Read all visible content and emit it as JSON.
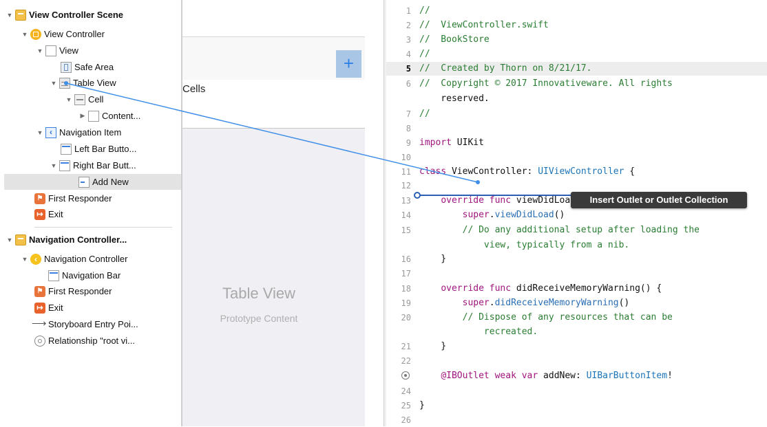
{
  "outline": {
    "items": [
      {
        "label": "View Controller Scene",
        "icon": "scene-icon",
        "bold": true
      },
      {
        "label": "View Controller",
        "icon": "view-controller-icon"
      },
      {
        "label": "View",
        "icon": "view-icon"
      },
      {
        "label": "Safe Area",
        "icon": "safe-area-icon"
      },
      {
        "label": "Table View",
        "icon": "table-view-icon"
      },
      {
        "label": "Cell",
        "icon": "cell-icon"
      },
      {
        "label": "Content...",
        "icon": "content-view-icon"
      },
      {
        "label": "Navigation Item",
        "icon": "navigation-item-icon"
      },
      {
        "label": "Left Bar Butto...",
        "icon": "bar-button-icon"
      },
      {
        "label": "Right Bar Butt...",
        "icon": "bar-button-icon"
      },
      {
        "label": "Add New",
        "icon": "bar-button-item-icon",
        "selected": true
      },
      {
        "label": "First Responder",
        "icon": "first-responder-icon"
      },
      {
        "label": "Exit",
        "icon": "exit-icon"
      },
      {
        "label": "Navigation Controller...",
        "icon": "scene-icon",
        "bold": true
      },
      {
        "label": "Navigation Controller",
        "icon": "navigation-controller-icon"
      },
      {
        "label": "Navigation Bar",
        "icon": "navigation-bar-icon"
      },
      {
        "label": "First Responder",
        "icon": "first-responder-icon"
      },
      {
        "label": "Exit",
        "icon": "exit-icon"
      },
      {
        "label": "Storyboard Entry Poi...",
        "icon": "arrow-icon"
      },
      {
        "label": "Relationship \"root vi...",
        "icon": "relationship-icon"
      }
    ]
  },
  "canvas": {
    "cells_label": "Cells",
    "plus_label": "+",
    "table_view_title": "Table View",
    "table_view_subtitle": "Prototype Content"
  },
  "editor": {
    "current_line": 5,
    "lines": [
      {
        "n": "1",
        "text": "//"
      },
      {
        "n": "2",
        "text": "//  ViewController.swift"
      },
      {
        "n": "3",
        "text": "//  BookStore"
      },
      {
        "n": "4",
        "text": "//"
      },
      {
        "n": "5",
        "text": "//  Created by Thorn on 8/21/17."
      },
      {
        "n": "6",
        "text": "//  Copyright © 2017 Innovativeware. All rights"
      },
      {
        "n": "",
        "text": "    reserved."
      },
      {
        "n": "7",
        "text": "//"
      },
      {
        "n": "8",
        "text": ""
      },
      {
        "n": "9",
        "text": "import UIKit"
      },
      {
        "n": "10",
        "text": ""
      },
      {
        "n": "11",
        "text": "class ViewController: UIViewController {"
      },
      {
        "n": "12",
        "text": ""
      },
      {
        "n": "13",
        "text": "    override func viewDidLoad() {"
      },
      {
        "n": "14",
        "text": "        super.viewDidLoad()"
      },
      {
        "n": "15",
        "text": "        // Do any additional setup after loading the"
      },
      {
        "n": "",
        "text": "            view, typically from a nib."
      },
      {
        "n": "16",
        "text": "    }"
      },
      {
        "n": "17",
        "text": ""
      },
      {
        "n": "18",
        "text": "    override func didReceiveMemoryWarning() {"
      },
      {
        "n": "19",
        "text": "        super.didReceiveMemoryWarning()"
      },
      {
        "n": "20",
        "text": "        // Dispose of any resources that can be"
      },
      {
        "n": "",
        "text": "            recreated."
      },
      {
        "n": "21",
        "text": "    }"
      },
      {
        "n": "22",
        "text": ""
      },
      {
        "n": "",
        "text": "    @IBOutlet weak var addNew: UIBarButtonItem!"
      },
      {
        "n": "24",
        "text": ""
      },
      {
        "n": "25",
        "text": "}"
      },
      {
        "n": "26",
        "text": ""
      }
    ]
  },
  "drag": {
    "tooltip": "Insert Outlet or Outlet Collection",
    "line_color": "#3f8fe8"
  }
}
